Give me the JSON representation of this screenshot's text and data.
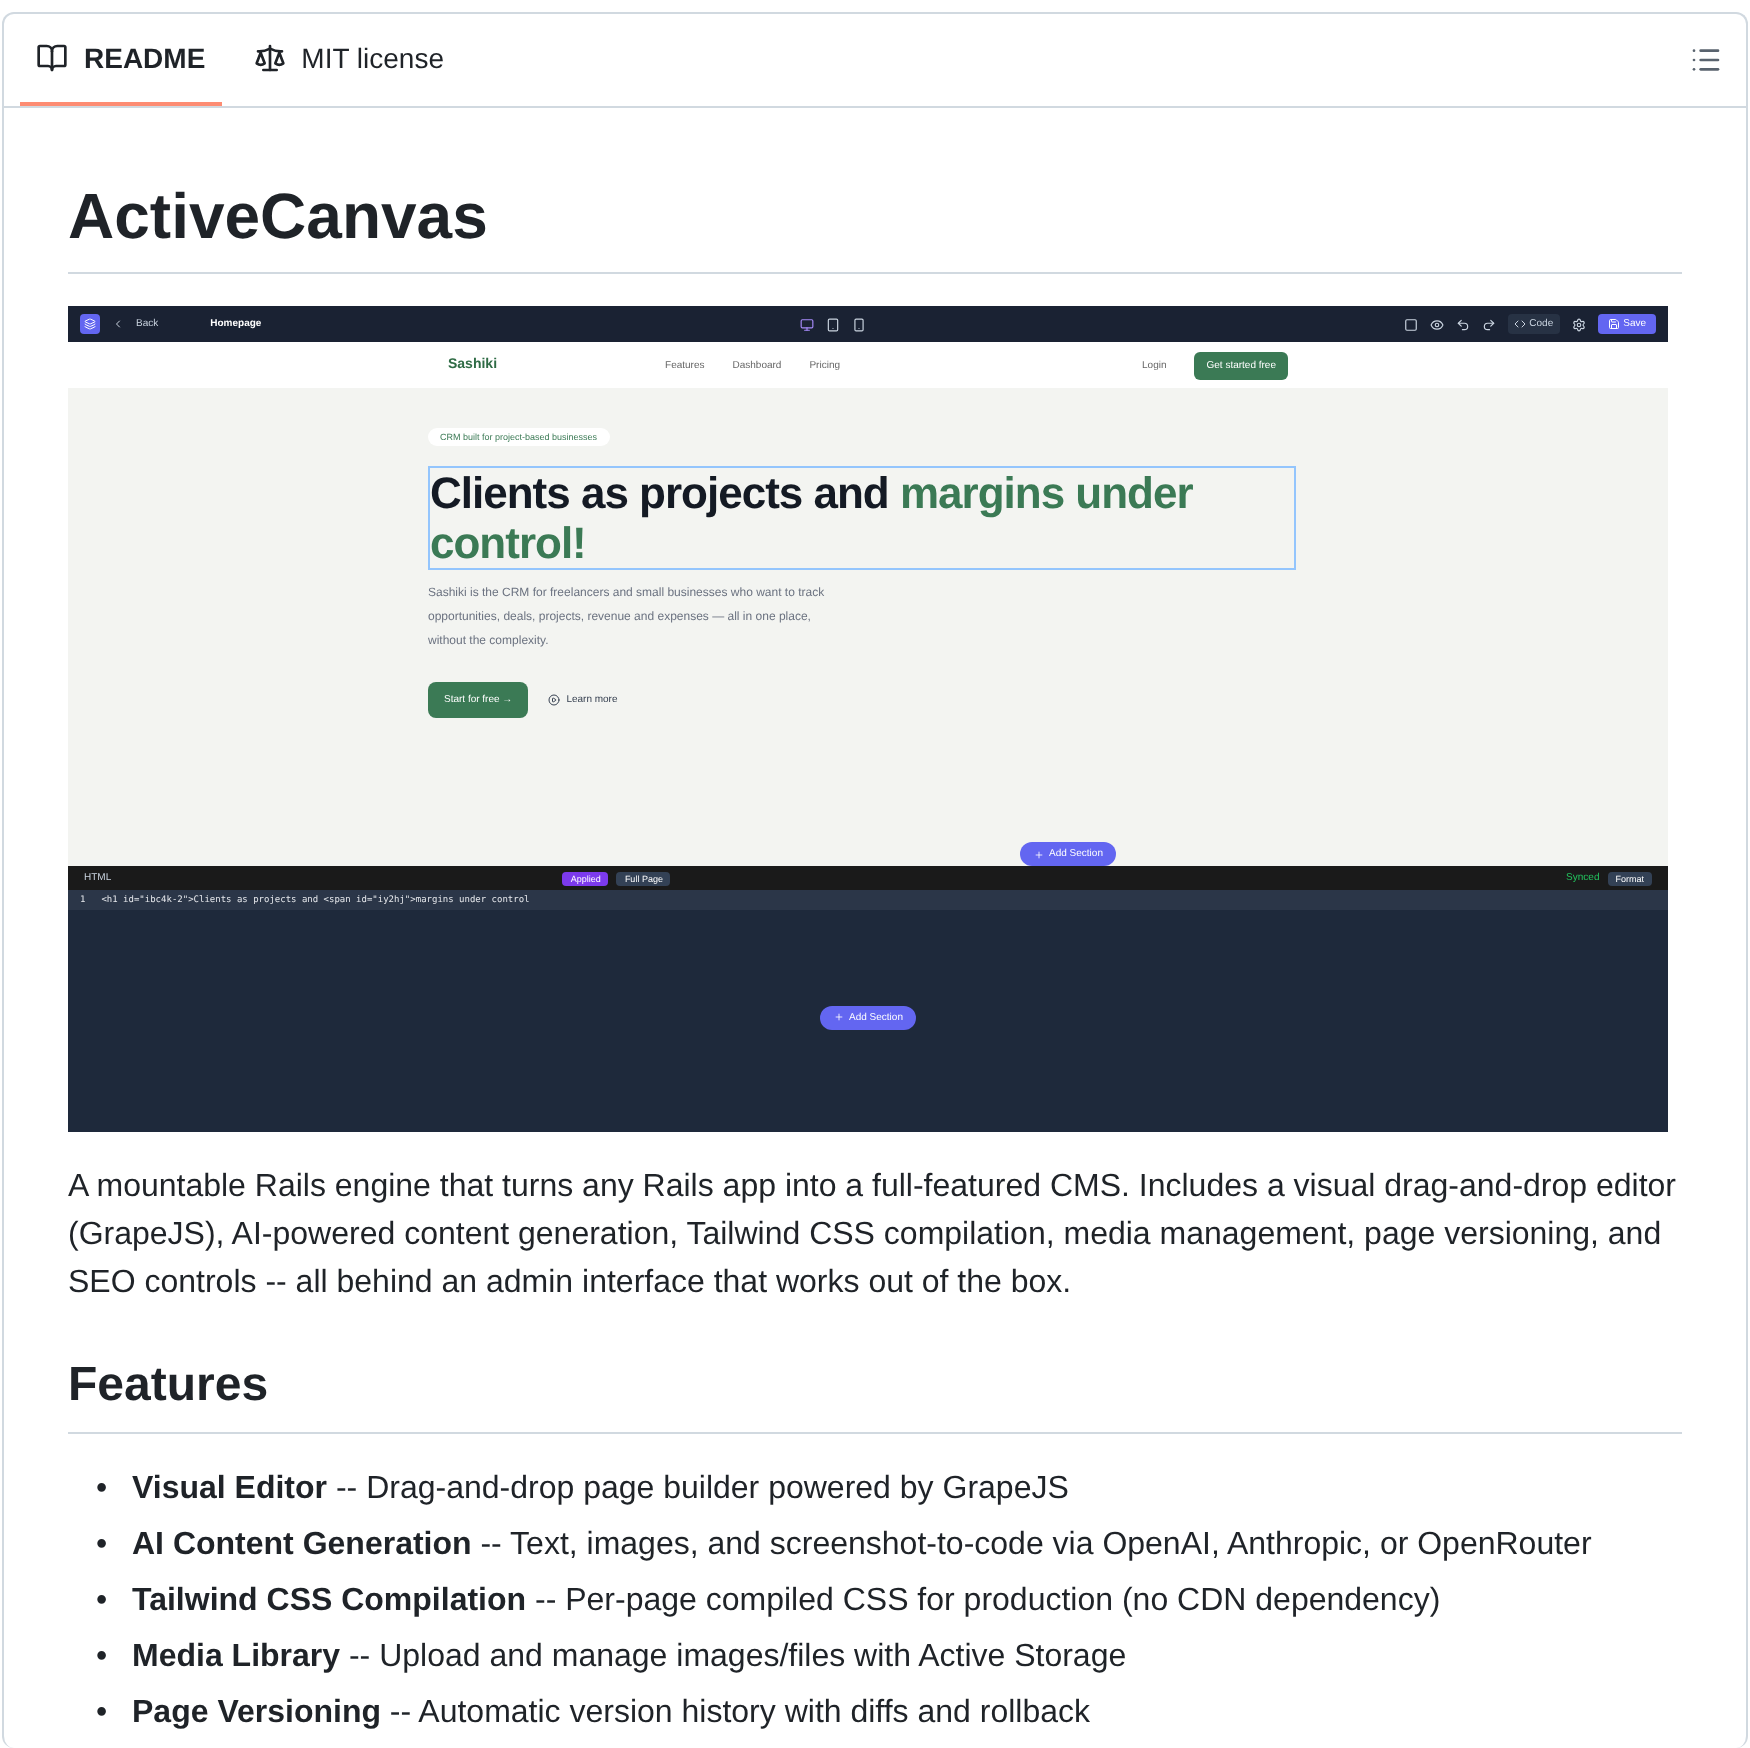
{
  "tabs": [
    {
      "label": "README",
      "selected": true
    },
    {
      "label": "MIT license",
      "selected": false
    }
  ],
  "title": "ActiveCanvas",
  "screenshot": {
    "toolbar": {
      "back": "Back",
      "page": "Homepage",
      "code": "Code",
      "save": "Save"
    },
    "site_nav": {
      "logo": "Sashiki",
      "links": [
        "Features",
        "Dashboard",
        "Pricing"
      ],
      "login": "Login",
      "cta": "Get started free"
    },
    "hero": {
      "badge": "CRM built for project-based businesses",
      "heading": "Clients as projects and",
      "heading_accent": "margins under control!",
      "text": "Sashiki is the CRM for freelancers and small businesses who want to track opportunities, deals, projects, revenue and expenses — all in one place, without the complexity.",
      "primary": "Start for free →",
      "secondary": "Learn more",
      "add_section": "Add Section"
    },
    "code_panel": {
      "label": "HTML",
      "buttons": [
        {
          "label": "Applied",
          "selected": true
        },
        {
          "label": "Full Page",
          "selected": false
        }
      ],
      "status": "Synced",
      "format": "Format",
      "line_number": "1",
      "code": "<h1 id=\"ibc4k-2\">Clients as projects and <span id=\"iy2hj\">margins under control",
      "add_section": "Add Section"
    }
  },
  "intro": "A mountable Rails engine that turns any Rails app into a full-featured CMS. Includes a visual drag-and-drop editor (GrapeJS), AI-powered content generation, Tailwind CSS compilation, media management, page versioning, and SEO controls -- all behind an admin interface that works out of the box.",
  "features_heading": "Features",
  "features": [
    {
      "marker": "•",
      "text": "**Visual Editor** -- Drag-and-drop page builder powered by GrapeJS"
    },
    {
      "marker": "•",
      "text": "**AI Content Generation** -- Text, images, and screenshot-to-code via OpenAI, Anthropic, or OpenRouter"
    },
    {
      "marker": "•",
      "text": "**Tailwind CSS Compilation** -- Per-page compiled CSS for production (no CDN dependency)"
    },
    {
      "marker": "•",
      "text": "**Media Library** -- Upload and manage images/files with Active Storage"
    },
    {
      "marker": "•",
      "text": "**Page Versioning** -- Automatic version history with diffs and rollback"
    }
  ]
}
